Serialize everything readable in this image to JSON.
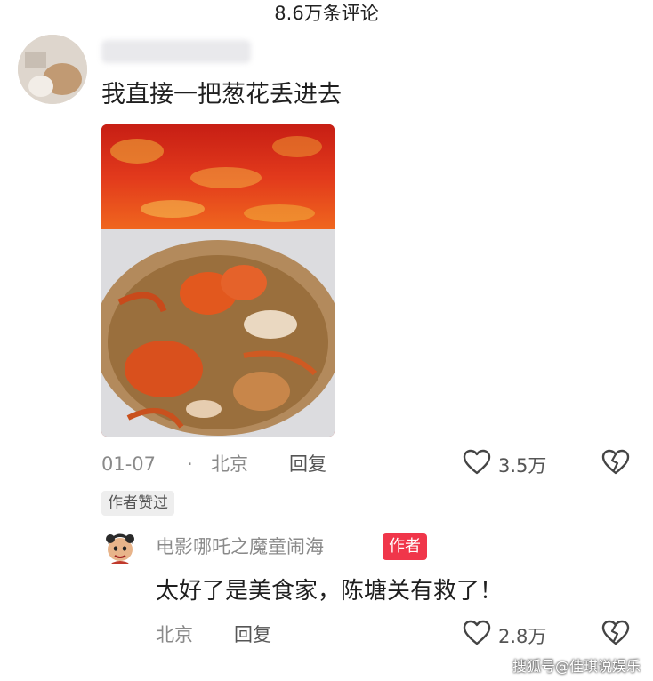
{
  "header": {
    "title": "8.6万条评论"
  },
  "comment": {
    "text": "我直接一把葱花丢进去",
    "date": "01-07",
    "separator": "·",
    "location": "北京",
    "reply_label": "回复",
    "like_count": "3.5万",
    "liked_by_author": "作者赞过"
  },
  "reply": {
    "author_name": "电影哪吒之魔童闹海",
    "author_badge": "作者",
    "text": "太好了是美食家，陈塘关有救了！",
    "location": "北京",
    "reply_label": "回复",
    "like_count": "2.8万"
  },
  "watermark": "搜狐号@佳琪说娱乐",
  "colors": {
    "accent_badge": "#f0364a",
    "meta_text": "#8a8a8a"
  },
  "icons": {
    "like": "heart-outline-icon",
    "dislike": "broken-heart-icon"
  }
}
